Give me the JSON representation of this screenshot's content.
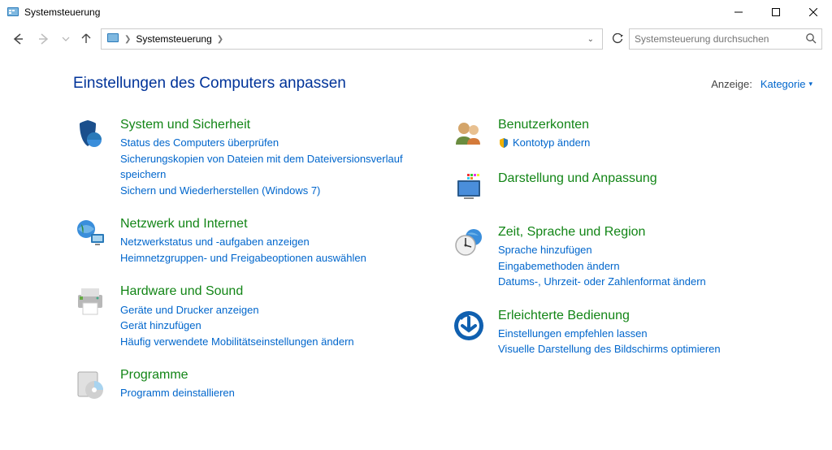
{
  "window": {
    "title": "Systemsteuerung"
  },
  "breadcrumb": {
    "root": "Systemsteuerung"
  },
  "search": {
    "placeholder": "Systemsteuerung durchsuchen"
  },
  "header": {
    "heading": "Einstellungen des Computers anpassen",
    "view_label": "Anzeige:",
    "view_value": "Kategorie"
  },
  "left": [
    {
      "id": "system",
      "title": "System und Sicherheit",
      "links": [
        "Status des Computers überprüfen",
        "Sicherungskopien von Dateien mit dem Dateiversionsverlauf speichern",
        "Sichern und Wiederherstellen (Windows 7)"
      ]
    },
    {
      "id": "network",
      "title": "Netzwerk und Internet",
      "links": [
        "Netzwerkstatus und -aufgaben anzeigen",
        "Heimnetzgruppen- und Freigabeoptionen auswählen"
      ]
    },
    {
      "id": "hardware",
      "title": "Hardware und Sound",
      "links": [
        "Geräte und Drucker anzeigen",
        "Gerät hinzufügen",
        "Häufig verwendete Mobilitätseinstellungen ändern"
      ]
    },
    {
      "id": "programs",
      "title": "Programme",
      "links": [
        "Programm deinstallieren"
      ]
    }
  ],
  "right": [
    {
      "id": "users",
      "title": "Benutzerkonten",
      "links": [
        "Kontotyp ändern"
      ],
      "shield": true
    },
    {
      "id": "appearance",
      "title": "Darstellung und Anpassung",
      "links": []
    },
    {
      "id": "clock",
      "title": "Zeit, Sprache und Region",
      "links": [
        "Sprache hinzufügen",
        "Eingabemethoden ändern",
        "Datums-, Uhrzeit- oder Zahlenformat ändern"
      ]
    },
    {
      "id": "ease",
      "title": "Erleichterte Bedienung",
      "links": [
        "Einstellungen empfehlen lassen",
        "Visuelle Darstellung des Bildschirms optimieren"
      ]
    }
  ]
}
